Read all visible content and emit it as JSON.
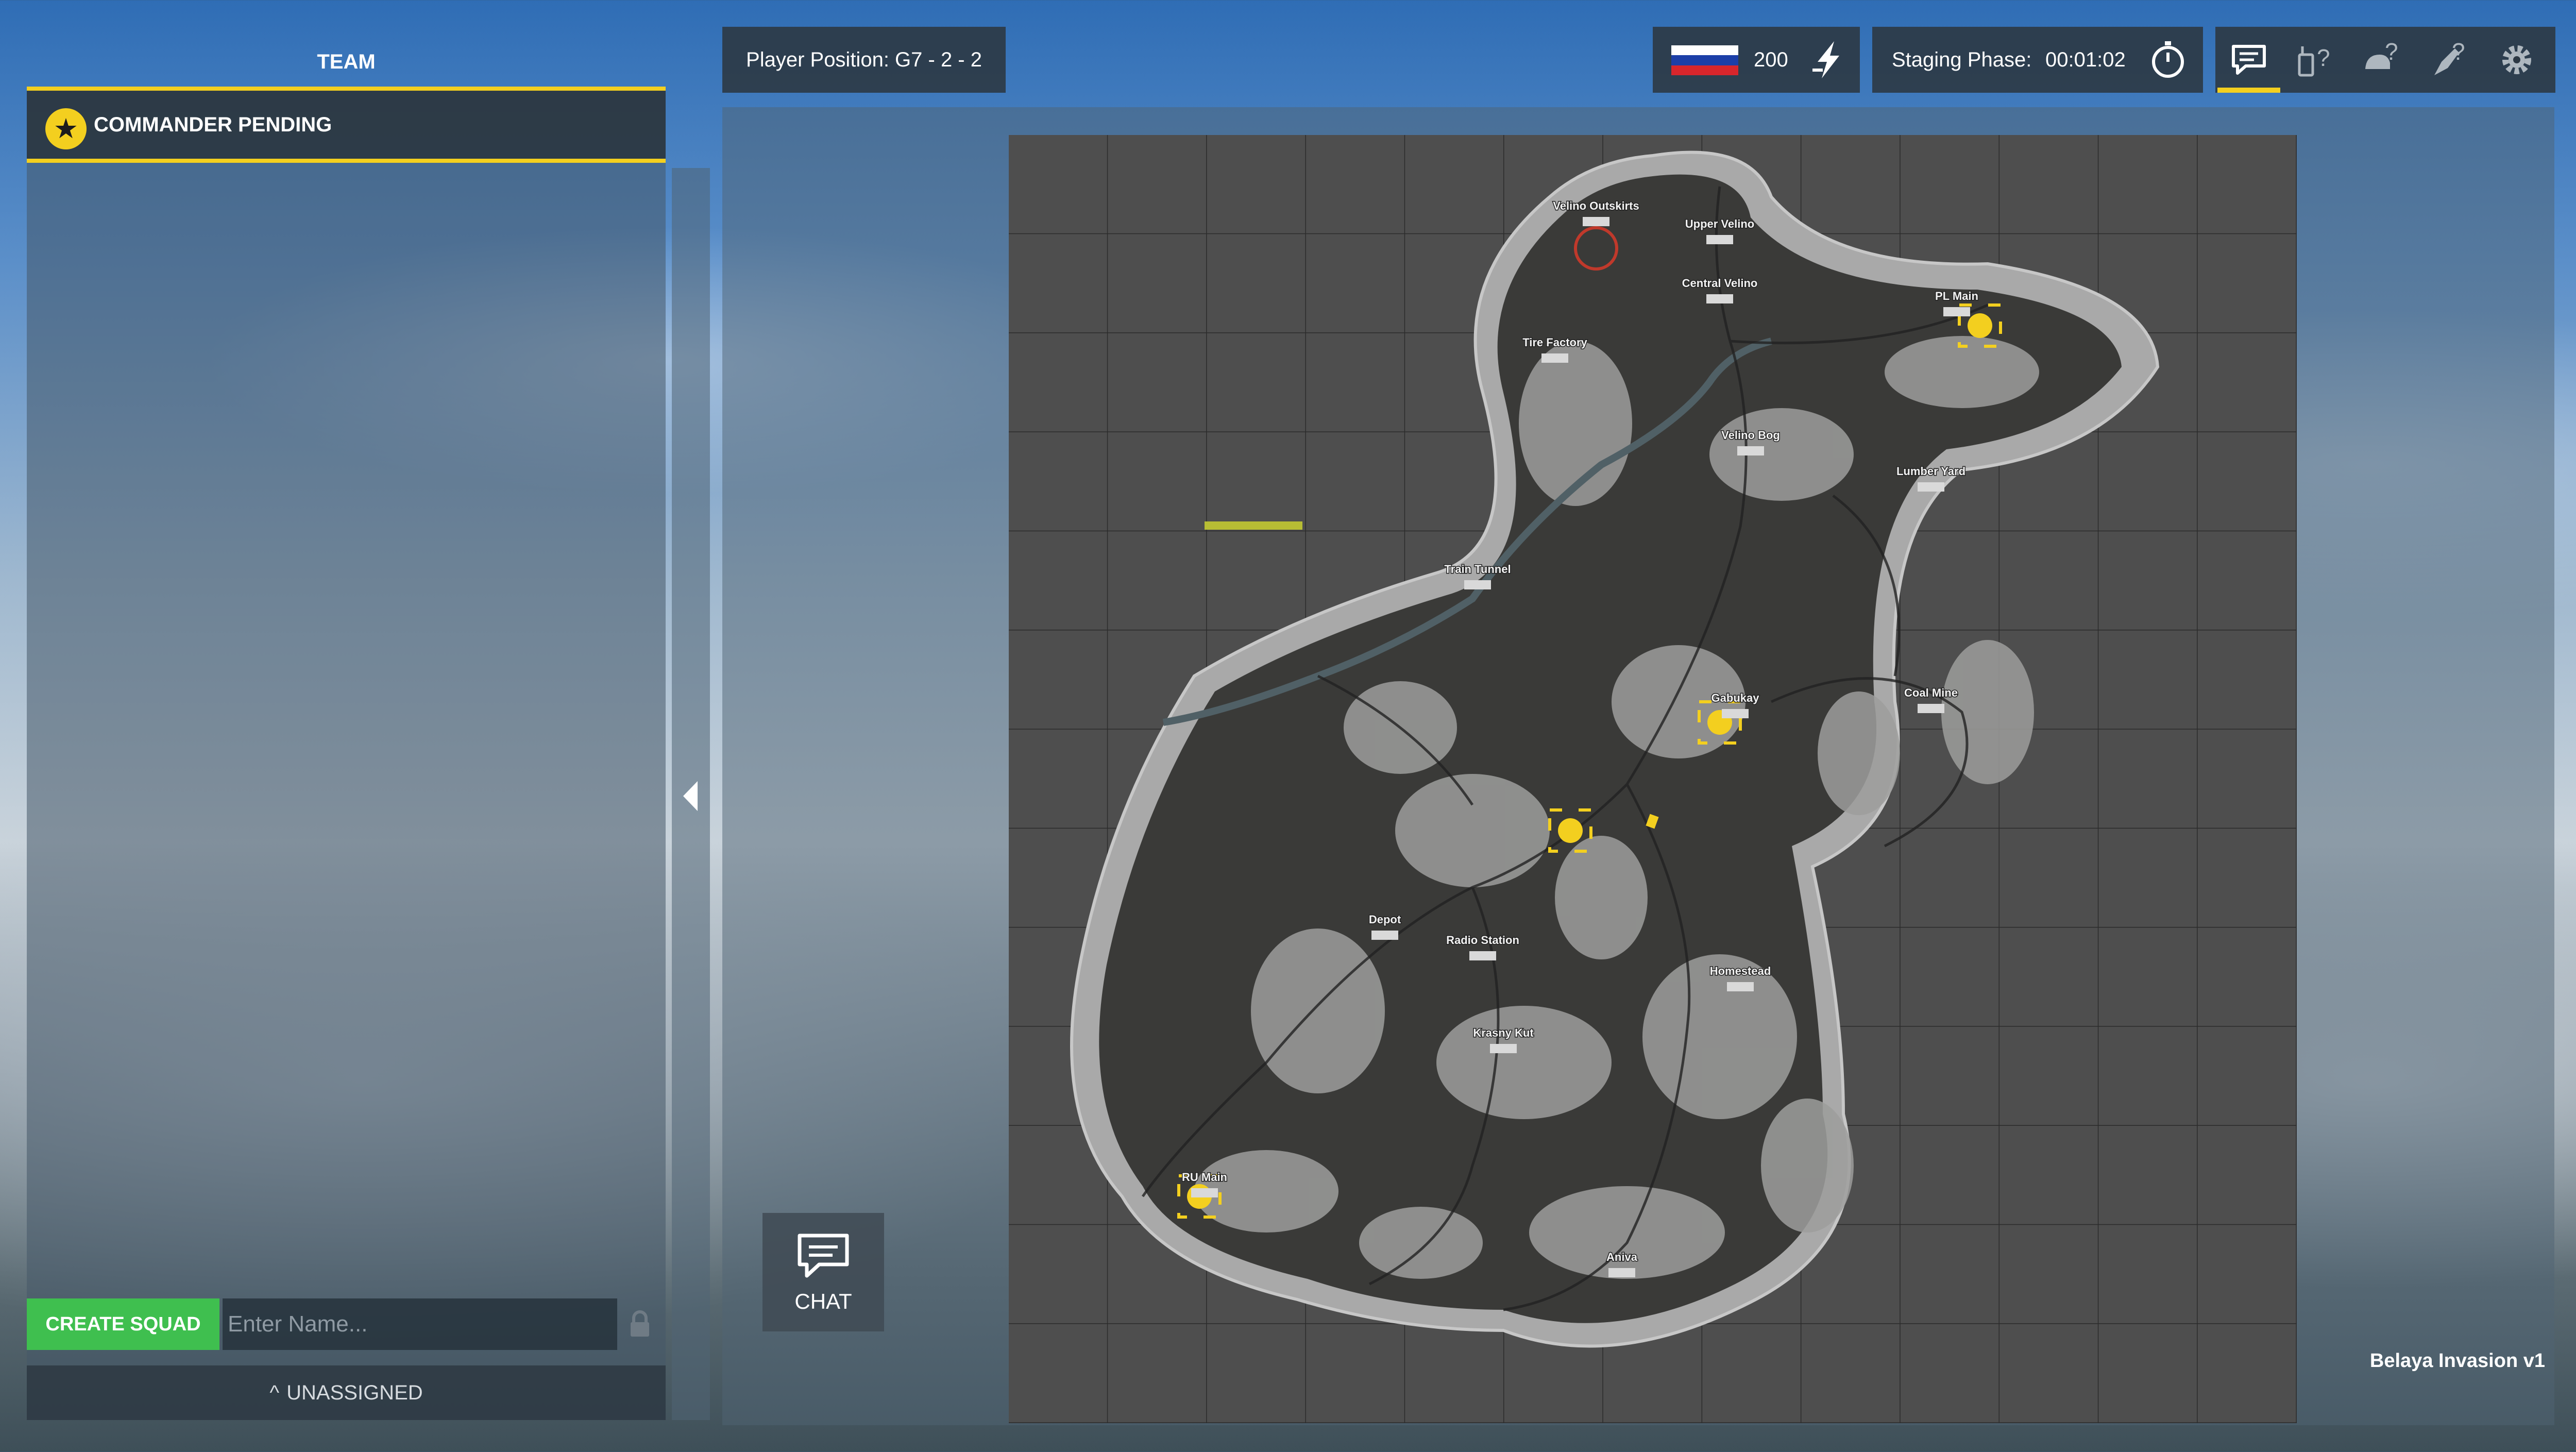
{
  "team_panel": {
    "title": "TEAM",
    "commander_label": "COMMANDER PENDING",
    "create_squad_label": "CREATE SQUAD",
    "squad_name_placeholder": "Enter Name...",
    "unassigned_label": "UNASSIGNED"
  },
  "header": {
    "player_position": "Player Position: G7 - 2 - 2",
    "faction_flag": "russia-flag",
    "tickets": "200",
    "phase_label": "Staging Phase:",
    "phase_timer": "00:01:02"
  },
  "toolbar": {
    "items": [
      {
        "icon": "chat-bubble-icon",
        "active": true
      },
      {
        "icon": "radio-help-icon",
        "active": false
      },
      {
        "icon": "helmet-help-icon",
        "active": false
      },
      {
        "icon": "rocket-help-icon",
        "active": false
      },
      {
        "icon": "gear-icon",
        "active": false
      }
    ]
  },
  "map": {
    "name": "Belaya Invasion v1",
    "chat_label": "CHAT",
    "locations": [
      {
        "name": "Velino Outskirts"
      },
      {
        "name": "Upper Velino"
      },
      {
        "name": "Central Velino"
      },
      {
        "name": "Tire Factory"
      },
      {
        "name": "Velino Bog"
      },
      {
        "name": "Lumber Yard"
      },
      {
        "name": "Train Tunnel"
      },
      {
        "name": "Gabukay"
      },
      {
        "name": "Coal Mine"
      },
      {
        "name": "Depot"
      },
      {
        "name": "Radio Station"
      },
      {
        "name": "Homestead"
      },
      {
        "name": "Krasny Kut"
      },
      {
        "name": "Aniva"
      },
      {
        "name": "RU Main"
      },
      {
        "name": "PL Main"
      }
    ],
    "accent_color": "#f3cf1f",
    "create_color": "#3fbf4f"
  }
}
